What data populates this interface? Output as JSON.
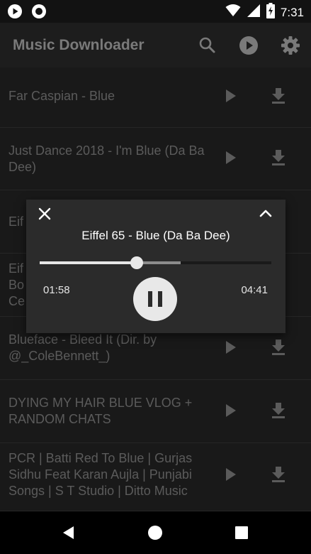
{
  "status_bar": {
    "time": "7:31",
    "left_icons": [
      "play-circle-icon",
      "record-icon"
    ],
    "right_icons": [
      "wifi-icon",
      "cellular-signal-icon",
      "battery-charging-icon"
    ]
  },
  "app_bar": {
    "title": "Music Downloader",
    "actions": [
      "search-icon",
      "play-circle-icon",
      "gear-icon"
    ]
  },
  "songs": [
    {
      "title": "Far Caspian - Blue"
    },
    {
      "title": "Just Dance 2018 - I'm Blue (Da Ba Dee)"
    },
    {
      "title": "Eif"
    },
    {
      "title": "Eif Bo Ce"
    },
    {
      "title": "Blueface - Bleed It (Dir. by @_ColeBennett_)"
    },
    {
      "title": "DYING MY HAIR BLUE VLOG + RANDOM CHATS"
    },
    {
      "title": "PCR | Batti Red To Blue | Gurjas Sidhu Feat Karan Aujla | Punjabi Songs | S T Studio | Ditto Music"
    }
  ],
  "player": {
    "title": "Eiffel 65 - Blue (Da Ba Dee)",
    "elapsed": "01:58",
    "duration": "04:41",
    "progress_fraction": 0.42,
    "buffered_fraction": 0.61
  },
  "colors": {
    "background": "#191919",
    "player_background": "#2b2b2b",
    "accent": "#e8e8e8"
  }
}
